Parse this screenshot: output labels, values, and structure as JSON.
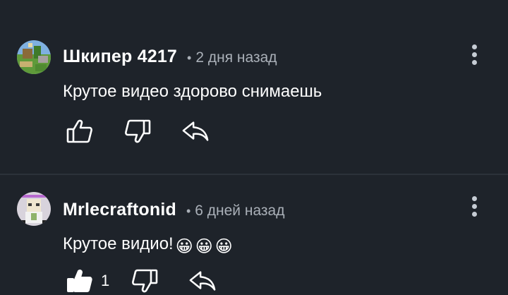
{
  "comments": [
    {
      "author": "Шкипер 4217",
      "time": "2 дня назад",
      "text": "Крутое видео здорово снимаешь",
      "avatar_icon": "minecraft-scene-avatar",
      "likes": ""
    },
    {
      "author": "Mrlecraftonid",
      "time": "6 дней назад",
      "text": "Крутое видио!",
      "emojis": [
        "😀",
        "😀",
        "😀"
      ],
      "avatar_icon": "minecraft-character-avatar",
      "likes": "1"
    }
  ],
  "separator": "•",
  "colors": {
    "background": "#1e232a",
    "meta": "#aab0b8",
    "divider": "#2c323a",
    "icon": "#ffffff"
  }
}
